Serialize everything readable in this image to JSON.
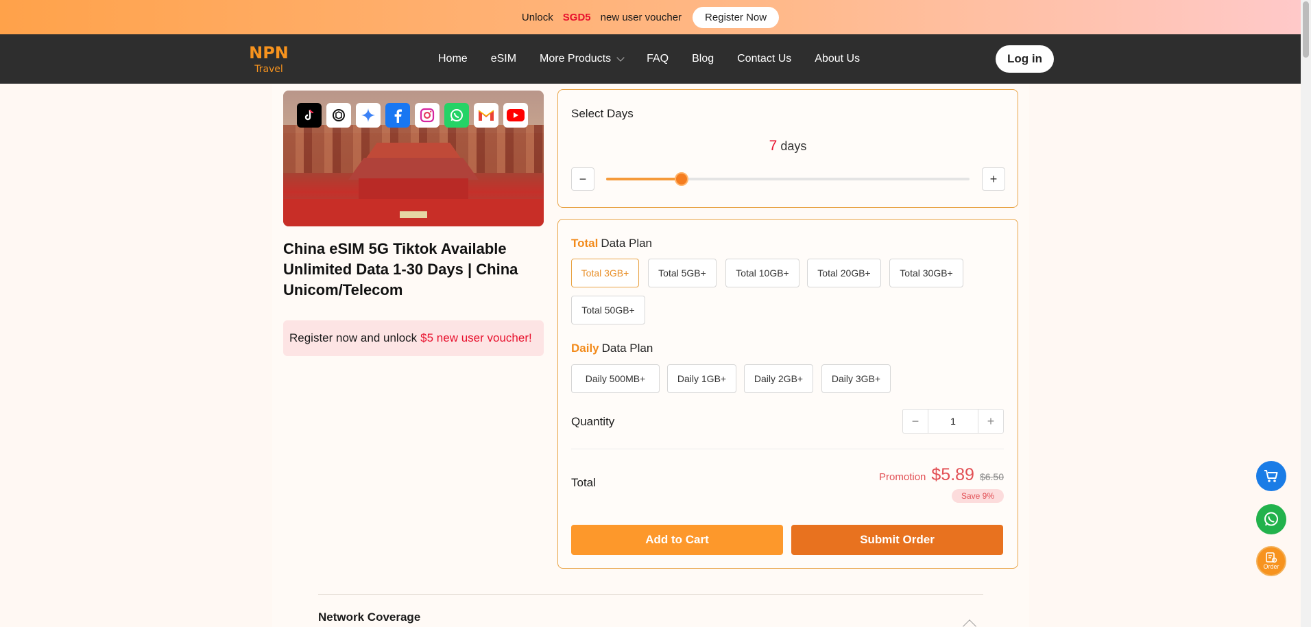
{
  "promo_bar": {
    "prefix": "Unlock",
    "voucher": "SGD5",
    "suffix": "new user voucher",
    "register_label": "Register Now"
  },
  "nav": {
    "logo_text": "NPN",
    "logo_sub": "Travel",
    "items": [
      "Home",
      "eSIM",
      "More Products",
      "FAQ",
      "Blog",
      "Contact Us",
      "About Us"
    ],
    "login_label": "Log in"
  },
  "product": {
    "title": "China eSIM 5G Tiktok Available Unlimited Data 1-30 Days | China Unicom/Telecom",
    "promo_text": "Register now and unlock",
    "promo_highlight": "$5 new user voucher!",
    "app_icons": [
      "tiktok-icon",
      "chatgpt-icon",
      "gemini-icon",
      "facebook-icon",
      "instagram-icon",
      "whatsapp-icon",
      "gmail-icon",
      "youtube-icon"
    ]
  },
  "days": {
    "label": "Select Days",
    "value": "7",
    "unit": "days",
    "min": 1,
    "max": 30,
    "minus": "−",
    "plus": "+"
  },
  "plans": {
    "total_hl": "Total",
    "total_rest": "Data Plan",
    "total_options": [
      "Total 3GB+",
      "Total 5GB+",
      "Total 10GB+",
      "Total 20GB+",
      "Total 30GB+",
      "Total 50GB+"
    ],
    "daily_hl": "Daily",
    "daily_rest": "Data Plan",
    "daily_options": [
      "Daily 500MB+",
      "Daily 1GB+",
      "Daily 2GB+",
      "Daily 3GB+"
    ],
    "selected": "Total 3GB+"
  },
  "quantity": {
    "label": "Quantity",
    "value": "1",
    "minus": "−",
    "plus": "+"
  },
  "total": {
    "label": "Total",
    "promotion": "Promotion",
    "price": "$5.89",
    "original": "$6.50",
    "save": "Save 9%"
  },
  "actions": {
    "add_to_cart": "Add to Cart",
    "submit_order": "Submit Order"
  },
  "coverage": {
    "title": "Network Coverage"
  },
  "fabs": {
    "order_label": "Order"
  },
  "colors": {
    "accent": "#f28a1a",
    "price_red": "#e24f54",
    "nav_bg": "#2e2e2e"
  }
}
